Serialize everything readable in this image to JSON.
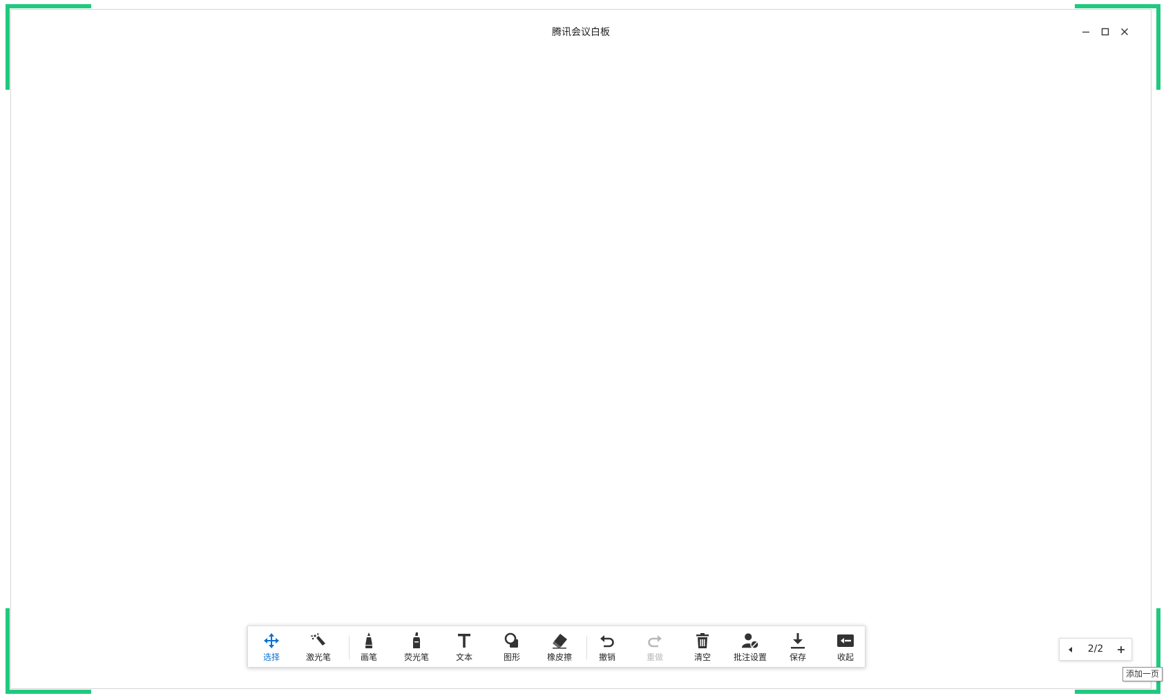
{
  "window": {
    "title": "腾讯会议白板"
  },
  "colors": {
    "accent": "#0a6fd8",
    "frame_corner": "#20c97f",
    "icon": "#333333",
    "disabled": "#b8b8b8"
  },
  "toolbar": {
    "tools": [
      {
        "label": "选择",
        "icon": "move-arrows-icon",
        "state": "active"
      },
      {
        "label": "激光笔",
        "icon": "laser-pointer-icon"
      },
      {
        "label": "画笔",
        "icon": "pen-icon"
      },
      {
        "label": "荧光笔",
        "icon": "highlighter-icon"
      },
      {
        "label": "文本",
        "icon": "text-icon"
      },
      {
        "label": "图形",
        "icon": "shape-icon"
      },
      {
        "label": "橡皮擦",
        "icon": "eraser-icon"
      },
      {
        "label": "撤销",
        "icon": "undo-icon"
      },
      {
        "label": "重做",
        "icon": "redo-icon",
        "state": "disabled"
      },
      {
        "label": "清空",
        "icon": "trash-icon"
      },
      {
        "label": "批注设置",
        "icon": "annotation-settings-icon"
      },
      {
        "label": "保存",
        "icon": "download-icon"
      },
      {
        "label": "收起",
        "icon": "collapse-icon"
      }
    ]
  },
  "pager": {
    "page": "2/2",
    "add_tooltip": "添加一页"
  }
}
